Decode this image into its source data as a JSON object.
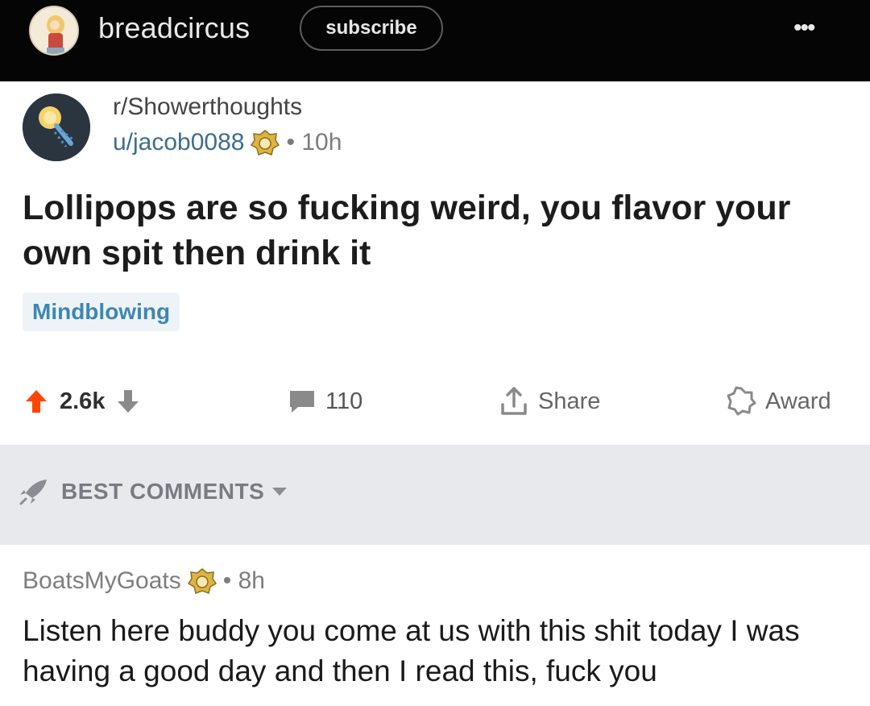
{
  "header": {
    "channel_name": "breadcircus",
    "subscribe_label": "subscribe",
    "more_label": "•••"
  },
  "post": {
    "subreddit": "r/Showerthoughts",
    "username": "u/jacob0088",
    "time": "• 10h",
    "title": "Lollipops are so fucking weird, you flavor your own spit then drink it",
    "flair": "Mindblowing"
  },
  "actions": {
    "vote_count": "2.6k",
    "comment_count": "110",
    "share_label": "Share",
    "award_label": "Award"
  },
  "sort": {
    "label": "BEST COMMENTS"
  },
  "comment": {
    "username": "BoatsMyGoats",
    "time": "• 8h",
    "body": "Listen here buddy you come at us with this shit today I was having a good day and then I read this, fuck you"
  },
  "colors": {
    "upvote": "#ff4500",
    "link_blue": "#3b6f8c",
    "flair_text": "#3d87b2",
    "sort_bg": "#e7e9ec"
  },
  "icons": {
    "upvote": "arrow-up-icon",
    "downvote": "arrow-down-icon",
    "comments": "comment-bubble-icon",
    "share": "share-icon",
    "award": "award-icon",
    "sort": "rocket-icon",
    "badge": "award-badge-icon"
  }
}
